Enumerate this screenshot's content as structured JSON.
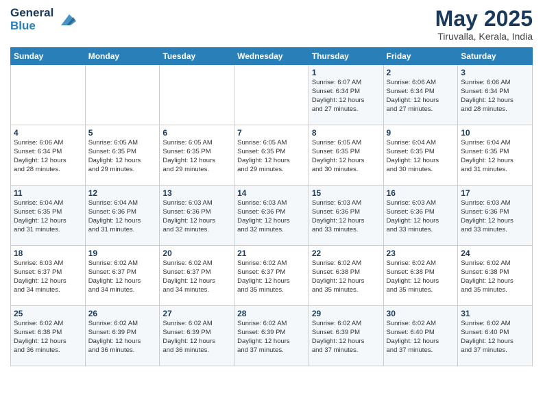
{
  "header": {
    "logo_line1": "General",
    "logo_line2": "Blue",
    "month_year": "May 2025",
    "location": "Tiruvalla, Kerala, India"
  },
  "weekdays": [
    "Sunday",
    "Monday",
    "Tuesday",
    "Wednesday",
    "Thursday",
    "Friday",
    "Saturday"
  ],
  "weeks": [
    [
      {
        "day": "",
        "info": ""
      },
      {
        "day": "",
        "info": ""
      },
      {
        "day": "",
        "info": ""
      },
      {
        "day": "",
        "info": ""
      },
      {
        "day": "1",
        "info": "Sunrise: 6:07 AM\nSunset: 6:34 PM\nDaylight: 12 hours\nand 27 minutes."
      },
      {
        "day": "2",
        "info": "Sunrise: 6:06 AM\nSunset: 6:34 PM\nDaylight: 12 hours\nand 27 minutes."
      },
      {
        "day": "3",
        "info": "Sunrise: 6:06 AM\nSunset: 6:34 PM\nDaylight: 12 hours\nand 28 minutes."
      }
    ],
    [
      {
        "day": "4",
        "info": "Sunrise: 6:06 AM\nSunset: 6:34 PM\nDaylight: 12 hours\nand 28 minutes."
      },
      {
        "day": "5",
        "info": "Sunrise: 6:05 AM\nSunset: 6:35 PM\nDaylight: 12 hours\nand 29 minutes."
      },
      {
        "day": "6",
        "info": "Sunrise: 6:05 AM\nSunset: 6:35 PM\nDaylight: 12 hours\nand 29 minutes."
      },
      {
        "day": "7",
        "info": "Sunrise: 6:05 AM\nSunset: 6:35 PM\nDaylight: 12 hours\nand 29 minutes."
      },
      {
        "day": "8",
        "info": "Sunrise: 6:05 AM\nSunset: 6:35 PM\nDaylight: 12 hours\nand 30 minutes."
      },
      {
        "day": "9",
        "info": "Sunrise: 6:04 AM\nSunset: 6:35 PM\nDaylight: 12 hours\nand 30 minutes."
      },
      {
        "day": "10",
        "info": "Sunrise: 6:04 AM\nSunset: 6:35 PM\nDaylight: 12 hours\nand 31 minutes."
      }
    ],
    [
      {
        "day": "11",
        "info": "Sunrise: 6:04 AM\nSunset: 6:35 PM\nDaylight: 12 hours\nand 31 minutes."
      },
      {
        "day": "12",
        "info": "Sunrise: 6:04 AM\nSunset: 6:36 PM\nDaylight: 12 hours\nand 31 minutes."
      },
      {
        "day": "13",
        "info": "Sunrise: 6:03 AM\nSunset: 6:36 PM\nDaylight: 12 hours\nand 32 minutes."
      },
      {
        "day": "14",
        "info": "Sunrise: 6:03 AM\nSunset: 6:36 PM\nDaylight: 12 hours\nand 32 minutes."
      },
      {
        "day": "15",
        "info": "Sunrise: 6:03 AM\nSunset: 6:36 PM\nDaylight: 12 hours\nand 33 minutes."
      },
      {
        "day": "16",
        "info": "Sunrise: 6:03 AM\nSunset: 6:36 PM\nDaylight: 12 hours\nand 33 minutes."
      },
      {
        "day": "17",
        "info": "Sunrise: 6:03 AM\nSunset: 6:36 PM\nDaylight: 12 hours\nand 33 minutes."
      }
    ],
    [
      {
        "day": "18",
        "info": "Sunrise: 6:03 AM\nSunset: 6:37 PM\nDaylight: 12 hours\nand 34 minutes."
      },
      {
        "day": "19",
        "info": "Sunrise: 6:02 AM\nSunset: 6:37 PM\nDaylight: 12 hours\nand 34 minutes."
      },
      {
        "day": "20",
        "info": "Sunrise: 6:02 AM\nSunset: 6:37 PM\nDaylight: 12 hours\nand 34 minutes."
      },
      {
        "day": "21",
        "info": "Sunrise: 6:02 AM\nSunset: 6:37 PM\nDaylight: 12 hours\nand 35 minutes."
      },
      {
        "day": "22",
        "info": "Sunrise: 6:02 AM\nSunset: 6:38 PM\nDaylight: 12 hours\nand 35 minutes."
      },
      {
        "day": "23",
        "info": "Sunrise: 6:02 AM\nSunset: 6:38 PM\nDaylight: 12 hours\nand 35 minutes."
      },
      {
        "day": "24",
        "info": "Sunrise: 6:02 AM\nSunset: 6:38 PM\nDaylight: 12 hours\nand 35 minutes."
      }
    ],
    [
      {
        "day": "25",
        "info": "Sunrise: 6:02 AM\nSunset: 6:38 PM\nDaylight: 12 hours\nand 36 minutes."
      },
      {
        "day": "26",
        "info": "Sunrise: 6:02 AM\nSunset: 6:39 PM\nDaylight: 12 hours\nand 36 minutes."
      },
      {
        "day": "27",
        "info": "Sunrise: 6:02 AM\nSunset: 6:39 PM\nDaylight: 12 hours\nand 36 minutes."
      },
      {
        "day": "28",
        "info": "Sunrise: 6:02 AM\nSunset: 6:39 PM\nDaylight: 12 hours\nand 37 minutes."
      },
      {
        "day": "29",
        "info": "Sunrise: 6:02 AM\nSunset: 6:39 PM\nDaylight: 12 hours\nand 37 minutes."
      },
      {
        "day": "30",
        "info": "Sunrise: 6:02 AM\nSunset: 6:40 PM\nDaylight: 12 hours\nand 37 minutes."
      },
      {
        "day": "31",
        "info": "Sunrise: 6:02 AM\nSunset: 6:40 PM\nDaylight: 12 hours\nand 37 minutes."
      }
    ]
  ]
}
